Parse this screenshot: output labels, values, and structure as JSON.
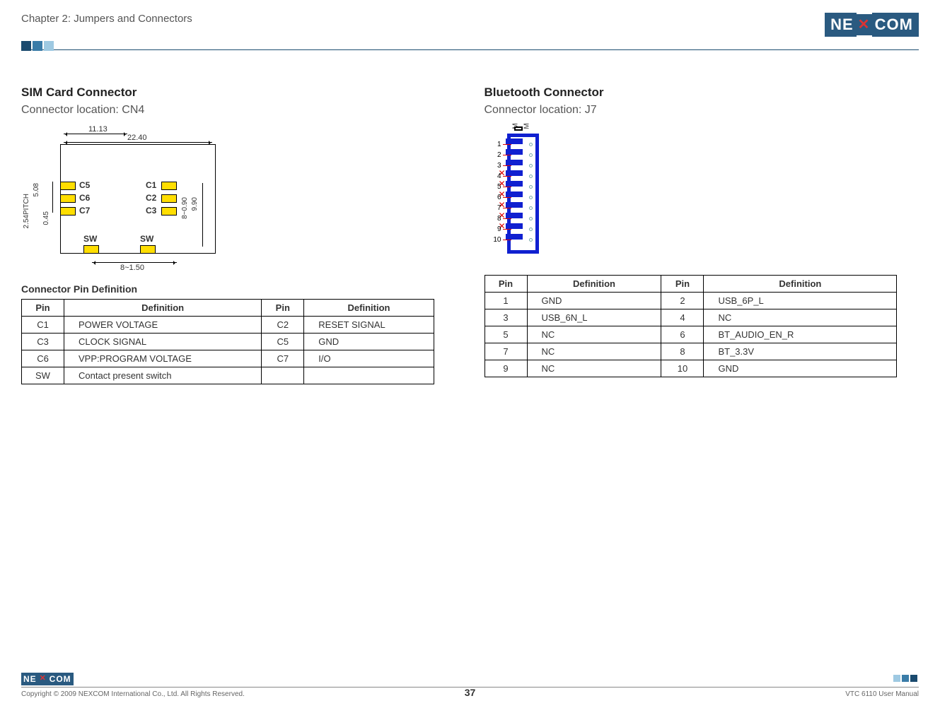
{
  "header": {
    "chapter": "Chapter 2: Jumpers and Connectors",
    "brand_left": "NE",
    "brand_right": "COM"
  },
  "left": {
    "title": "SIM Card Connector",
    "location": "Connector location: CN4",
    "dims": {
      "top_inner": "11.13",
      "top_outer": "22.40",
      "right_inner": "8~0.90",
      "right_outer": "9.90",
      "bottom": "8~1.50",
      "left_pitch_label": "2.54PITCH",
      "left_h": "5.08",
      "left_gap": "0.45"
    },
    "pads": {
      "c5": "C5",
      "c6": "C6",
      "c7": "C7",
      "c1": "C1",
      "c2": "C2",
      "c3": "C3",
      "sw_l": "SW",
      "sw_r": "SW"
    },
    "table_title": "Connector Pin Definition",
    "headers": {
      "pin": "Pin",
      "def": "Definition"
    },
    "rows": [
      {
        "p1": "C1",
        "d1": "POWER VOLTAGE",
        "p2": "C2",
        "d2": "RESET SIGNAL"
      },
      {
        "p1": "C3",
        "d1": "CLOCK SIGNAL",
        "p2": "C5",
        "d2": "GND"
      },
      {
        "p1": "C6",
        "d1": "VPP:PROGRAM VOLTAGE",
        "p2": "C7",
        "d2": "I/O"
      },
      {
        "p1": "SW",
        "d1": "Contact present switch",
        "p2": "",
        "d2": ""
      }
    ]
  },
  "right": {
    "title": "Bluetooth Connector",
    "location": "Connector location: J7",
    "mark": "M",
    "pin_numbers": [
      "1",
      "2",
      "3",
      "4",
      "5",
      "6",
      "7",
      "8",
      "9",
      "10"
    ],
    "x_rows": [
      3,
      4,
      5,
      6,
      7,
      8
    ],
    "headers": {
      "pin": "Pin",
      "def": "Definition"
    },
    "rows": [
      {
        "p1": "1",
        "d1": "GND",
        "p2": "2",
        "d2": "USB_6P_L"
      },
      {
        "p1": "3",
        "d1": "USB_6N_L",
        "p2": "4",
        "d2": "NC"
      },
      {
        "p1": "5",
        "d1": "NC",
        "p2": "6",
        "d2": "BT_AUDIO_EN_R"
      },
      {
        "p1": "7",
        "d1": "NC",
        "p2": "8",
        "d2": "BT_3.3V"
      },
      {
        "p1": "9",
        "d1": "NC",
        "p2": "10",
        "d2": "GND"
      }
    ]
  },
  "footer": {
    "copyright": "Copyright © 2009 NEXCOM International Co., Ltd. All Rights Reserved.",
    "page": "37",
    "manual": "VTC 6110 User Manual"
  }
}
